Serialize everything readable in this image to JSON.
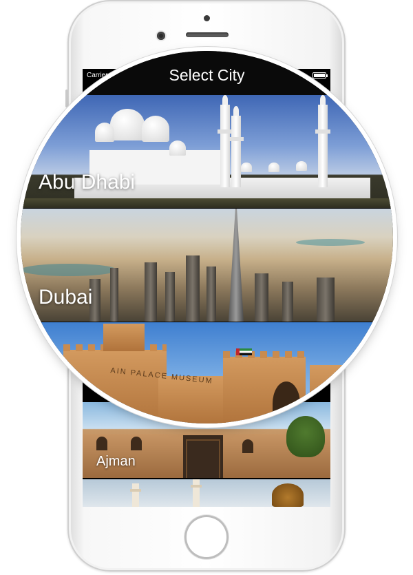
{
  "status_bar": {
    "carrier": "Carrier",
    "wifi_icon": "wifi-icon",
    "battery_icon": "battery-icon"
  },
  "nav_bar": {
    "title": "Select City"
  },
  "cities": [
    {
      "name": "Abu Dhabi"
    },
    {
      "name": "Dubai"
    },
    {
      "name": ""
    },
    {
      "name": "Ajman"
    },
    {
      "name": ""
    }
  ],
  "alain_sign": "AIN PALACE MUSEUM",
  "colors": {
    "nav_bar_bg": "#0a0a0a",
    "phone_body": "#ffffff",
    "label_text": "#ffffff"
  }
}
